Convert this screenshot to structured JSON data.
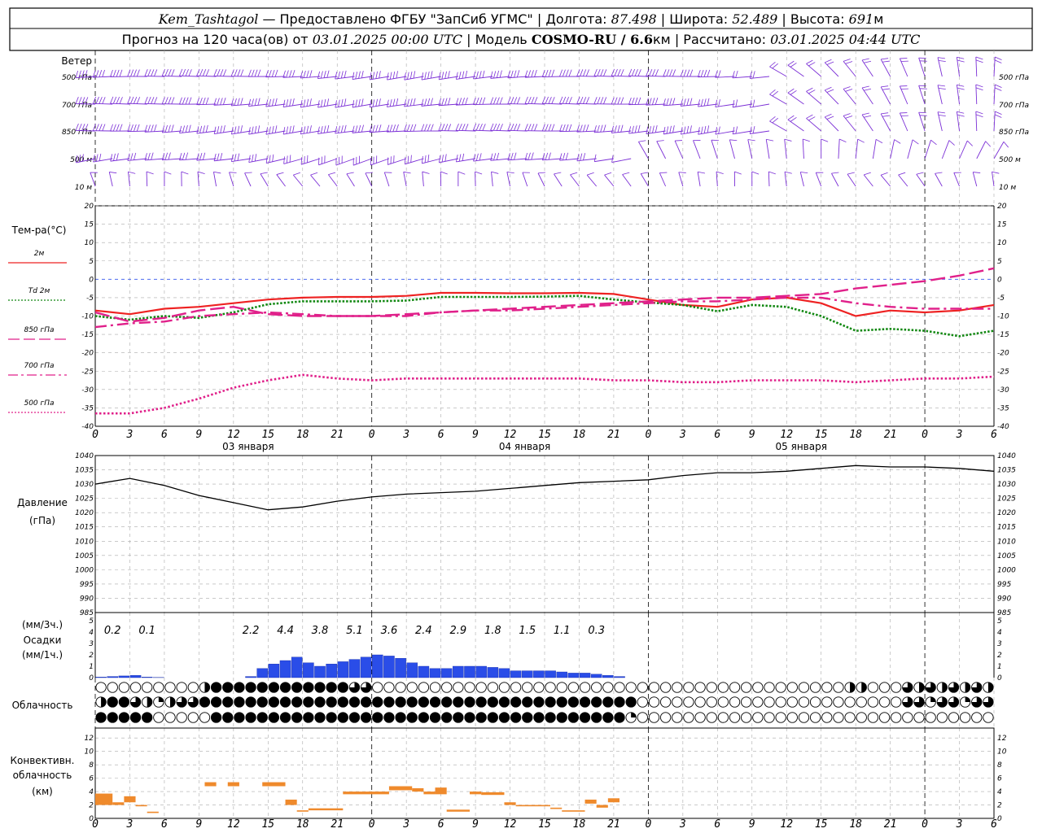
{
  "header": {
    "line1": {
      "station": "Kem_Tashtagol",
      "provider": "— Предоставлено ФГБУ \"ЗапСиб УГМС\"",
      "lon_label": "| Долгота:",
      "lon": "87.498",
      "lat_label": "| Широта:",
      "lat": "52.489",
      "alt_label": "| Высота:",
      "alt": "691",
      "alt_unit": "м"
    },
    "line2": {
      "forecast_label": "Прогноз на 120 часа(ов) от",
      "start": "03.01.2025 00:00 UTC",
      "model_label": "| Модель",
      "model": "COSMO-RU / 6.6",
      "model_unit": "км",
      "calc_label": "| Рассчитано:",
      "calc": "03.01.2025 04:44 UTC"
    }
  },
  "wind": {
    "title": "Ветер",
    "levels": [
      "500 гПа",
      "700 гПа",
      "850 гПа",
      "500 м",
      "10 м"
    ],
    "barb_color": "#7b2fd6"
  },
  "temperature": {
    "title": "Тем-ра(°С)",
    "yticks": [
      20,
      15,
      10,
      5,
      0,
      -5,
      -10,
      -15,
      -20,
      -25,
      -30,
      -35,
      -40
    ],
    "legend": [
      {
        "label": "2м",
        "color": "#ee2222",
        "style": "solid"
      },
      {
        "label": "Td  2м",
        "color": "#118811",
        "style": "dotted"
      },
      {
        "label": "850 гПа",
        "color": "#e0208a",
        "style": "longdash"
      },
      {
        "label": "700 гПа",
        "color": "#e0208a",
        "style": "dashdot"
      },
      {
        "label": "500 гПа",
        "color": "#e0208a",
        "style": "dotted"
      }
    ],
    "day_labels": [
      "03 января",
      "04 января",
      "05 января"
    ]
  },
  "pressure": {
    "title": "Давление",
    "unit": "(гПа)",
    "yticks": [
      1040,
      1035,
      1030,
      1025,
      1020,
      1015,
      1010,
      1005,
      1000,
      995,
      990,
      985
    ]
  },
  "precipitation": {
    "unit_3h": "(мм/3ч.)",
    "title": "Осадки",
    "unit_1h": "(мм/1ч.)",
    "yticks": [
      5,
      4,
      3,
      2,
      1,
      0
    ],
    "totals_3h": [
      {
        "hour": 3,
        "label": "0.2"
      },
      {
        "hour": 6,
        "label": "0.1"
      },
      {
        "hour": 15,
        "label": "2.2"
      },
      {
        "hour": 18,
        "label": "4.4"
      },
      {
        "hour": 21,
        "label": "3.8"
      },
      {
        "hour": 24,
        "label": "5.1"
      },
      {
        "hour": 27,
        "label": "3.6"
      },
      {
        "hour": 30,
        "label": "2.4"
      },
      {
        "hour": 33,
        "label": "2.9"
      },
      {
        "hour": 36,
        "label": "1.8"
      },
      {
        "hour": 39,
        "label": "1.5"
      },
      {
        "hour": 42,
        "label": "1.1"
      },
      {
        "hour": 45,
        "label": "0.3"
      }
    ]
  },
  "cloudiness": {
    "title": "Облачность"
  },
  "convective": {
    "title1": "Конвективн.",
    "title2": "облачность",
    "unit": "(км)",
    "yticks": [
      12,
      10,
      8,
      6,
      4,
      2,
      0
    ]
  },
  "x_axis": {
    "tick_labels": [
      "0",
      "3",
      "6",
      "9",
      "12",
      "15",
      "18",
      "21",
      "0",
      "3",
      "6",
      "9",
      "12",
      "15",
      "18",
      "21",
      "0",
      "3",
      "6",
      "9",
      "12",
      "15",
      "18",
      "21",
      "0",
      "3",
      "6"
    ]
  },
  "chart_data": {
    "type": "line",
    "x_unit": "hours since 03.01.2025 00:00 UTC",
    "series_temperature": [
      {
        "name": "2м",
        "x": [
          0,
          3,
          6,
          9,
          12,
          15,
          18,
          21,
          24,
          27,
          30,
          33,
          36,
          39,
          42,
          45,
          48,
          51,
          54,
          57,
          60,
          63,
          66,
          69,
          72,
          75,
          78
        ],
        "values": [
          -8.5,
          -9.5,
          -8.0,
          -7.5,
          -6.5,
          -5.5,
          -5.0,
          -4.8,
          -4.8,
          -4.5,
          -3.7,
          -3.7,
          -3.8,
          -3.8,
          -3.7,
          -4.0,
          -5.5,
          -7.0,
          -7.5,
          -5.5,
          -5.0,
          -6.5,
          -10.0,
          -8.5,
          -9.0,
          -8.5,
          -7.0
        ]
      },
      {
        "name": "Td  2м",
        "x": [
          0,
          3,
          6,
          9,
          12,
          15,
          18,
          21,
          24,
          27,
          30,
          33,
          36,
          39,
          42,
          45,
          48,
          51,
          54,
          57,
          60,
          63,
          66,
          69,
          72,
          75,
          78
        ],
        "values": [
          -10.0,
          -11.0,
          -10.0,
          -10.5,
          -9.0,
          -6.8,
          -6.0,
          -6.0,
          -6.0,
          -5.8,
          -4.8,
          -4.8,
          -4.8,
          -4.7,
          -4.5,
          -5.5,
          -6.3,
          -7.0,
          -8.7,
          -7.0,
          -7.5,
          -10.0,
          -14.0,
          -13.5,
          -14.0,
          -15.5,
          -14.0
        ]
      },
      {
        "name": "850 гПа",
        "x": [
          0,
          3,
          6,
          9,
          12,
          15,
          18,
          21,
          24,
          27,
          30,
          33,
          36,
          39,
          42,
          45,
          48,
          51,
          54,
          57,
          60,
          63,
          66,
          69,
          72,
          75,
          78
        ],
        "values": [
          -9.0,
          -11.5,
          -10.5,
          -8.5,
          -7.5,
          -9.5,
          -10.0,
          -10.0,
          -10.0,
          -9.5,
          -9.0,
          -8.5,
          -8.0,
          -7.5,
          -7.0,
          -6.5,
          -6.0,
          -5.5,
          -5.0,
          -5.0,
          -4.5,
          -4.0,
          -2.5,
          -1.5,
          -0.5,
          1.0,
          3.0
        ]
      },
      {
        "name": "700 гПа",
        "x": [
          0,
          3,
          6,
          9,
          12,
          15,
          18,
          21,
          24,
          27,
          30,
          33,
          36,
          39,
          42,
          45,
          48,
          51,
          54,
          57,
          60,
          63,
          66,
          69,
          72,
          75,
          78
        ],
        "values": [
          -13.0,
          -12.0,
          -11.5,
          -10.0,
          -9.5,
          -9.0,
          -9.5,
          -10.0,
          -10.0,
          -10.0,
          -9.0,
          -8.5,
          -8.5,
          -8.0,
          -7.5,
          -7.0,
          -6.5,
          -6.0,
          -6.0,
          -5.5,
          -5.0,
          -5.0,
          -6.5,
          -7.5,
          -8.0,
          -8.0,
          -8.0
        ]
      },
      {
        "name": "500 гПа",
        "x": [
          0,
          3,
          6,
          9,
          12,
          15,
          18,
          21,
          24,
          27,
          30,
          33,
          36,
          39,
          42,
          45,
          48,
          51,
          54,
          57,
          60,
          63,
          66,
          69,
          72,
          75,
          78
        ],
        "values": [
          -36.5,
          -36.5,
          -35.0,
          -32.5,
          -29.5,
          -27.5,
          -26.0,
          -27.0,
          -27.5,
          -27.0,
          -27.0,
          -27.0,
          -27.0,
          -27.0,
          -27.0,
          -27.5,
          -27.5,
          -28.0,
          -28.0,
          -27.5,
          -27.5,
          -27.5,
          -28.0,
          -27.5,
          -27.0,
          -27.0,
          -26.5
        ]
      }
    ],
    "series_pressure": {
      "name": "Давление",
      "x": [
        0,
        3,
        6,
        9,
        12,
        15,
        18,
        21,
        24,
        27,
        30,
        33,
        36,
        39,
        42,
        45,
        48,
        51,
        54,
        57,
        60,
        63,
        66,
        69,
        72,
        75,
        78
      ],
      "values": [
        1030.0,
        1032.0,
        1029.5,
        1026.0,
        1023.5,
        1021.0,
        1022.0,
        1024.0,
        1025.5,
        1026.5,
        1027.0,
        1027.5,
        1028.5,
        1029.5,
        1030.5,
        1031.0,
        1031.5,
        1033.0,
        1034.0,
        1034.0,
        1034.5,
        1035.5,
        1036.5,
        1036.0,
        1036.0,
        1035.5,
        1034.5
      ]
    },
    "series_precip_1h": {
      "name": "Осадки",
      "x": [
        0,
        1,
        2,
        3,
        4,
        5,
        6,
        7,
        8,
        9,
        10,
        11,
        12,
        13,
        14,
        15,
        16,
        17,
        18,
        19,
        20,
        21,
        22,
        23,
        24,
        25,
        26,
        27,
        28,
        29,
        30,
        31,
        32,
        33,
        34,
        35,
        36,
        37,
        38,
        39,
        40,
        41,
        42,
        43,
        44,
        45,
        46,
        47
      ],
      "values": [
        0.05,
        0.1,
        0.15,
        0.2,
        0.05,
        0.02,
        0,
        0,
        0,
        0,
        0,
        0,
        0,
        0.1,
        0.8,
        1.2,
        1.5,
        1.8,
        1.3,
        1.0,
        1.2,
        1.4,
        1.6,
        1.8,
        2.0,
        1.9,
        1.7,
        1.3,
        1.0,
        0.8,
        0.8,
        1.0,
        1.0,
        1.0,
        0.9,
        0.8,
        0.6,
        0.6,
        0.6,
        0.6,
        0.5,
        0.4,
        0.4,
        0.3,
        0.2,
        0.1,
        0,
        0
      ]
    },
    "series_convective": {
      "name": "Конвективн. облачность",
      "segments": [
        {
          "h0": 0,
          "h1": 1.5,
          "lo": 2.0,
          "hi": 3.7
        },
        {
          "h0": 1.5,
          "h1": 2.5,
          "lo": 2.0,
          "hi": 2.4
        },
        {
          "h0": 2.5,
          "h1": 3.5,
          "lo": 2.4,
          "hi": 3.3
        },
        {
          "h0": 3.5,
          "h1": 4.5,
          "lo": 1.8,
          "hi": 2.0
        },
        {
          "h0": 4.5,
          "h1": 5.5,
          "lo": 0.8,
          "hi": 1.0
        },
        {
          "h0": 9.5,
          "h1": 10.5,
          "lo": 4.8,
          "hi": 5.4
        },
        {
          "h0": 11.5,
          "h1": 12.5,
          "lo": 4.8,
          "hi": 5.4
        },
        {
          "h0": 14.5,
          "h1": 16.5,
          "lo": 4.8,
          "hi": 5.4
        },
        {
          "h0": 16.5,
          "h1": 17.5,
          "lo": 2.0,
          "hi": 2.8
        },
        {
          "h0": 17.5,
          "h1": 18.5,
          "lo": 1.0,
          "hi": 1.2
        },
        {
          "h0": 18.5,
          "h1": 21.5,
          "lo": 1.2,
          "hi": 1.5
        },
        {
          "h0": 21.5,
          "h1": 25.5,
          "lo": 3.6,
          "hi": 4.0
        },
        {
          "h0": 25.5,
          "h1": 27.5,
          "lo": 4.2,
          "hi": 4.8
        },
        {
          "h0": 27.5,
          "h1": 28.5,
          "lo": 4.0,
          "hi": 4.5
        },
        {
          "h0": 28.5,
          "h1": 29.5,
          "lo": 3.6,
          "hi": 4.0
        },
        {
          "h0": 29.5,
          "h1": 30.5,
          "lo": 3.6,
          "hi": 4.6
        },
        {
          "h0": 30.5,
          "h1": 32.5,
          "lo": 1.0,
          "hi": 1.3
        },
        {
          "h0": 32.5,
          "h1": 33.5,
          "lo": 3.6,
          "hi": 4.0
        },
        {
          "h0": 33.5,
          "h1": 35.5,
          "lo": 3.5,
          "hi": 3.9
        },
        {
          "h0": 35.5,
          "h1": 36.5,
          "lo": 2.0,
          "hi": 2.4
        },
        {
          "h0": 36.5,
          "h1": 39.5,
          "lo": 1.8,
          "hi": 2.0
        },
        {
          "h0": 39.5,
          "h1": 40.5,
          "lo": 1.4,
          "hi": 1.6
        },
        {
          "h0": 40.5,
          "h1": 42.5,
          "lo": 1.0,
          "hi": 1.2
        },
        {
          "h0": 42.5,
          "h1": 43.5,
          "lo": 2.2,
          "hi": 2.8
        },
        {
          "h0": 43.5,
          "h1": 44.5,
          "lo": 1.6,
          "hi": 2.0
        },
        {
          "h0": 44.5,
          "h1": 45.5,
          "lo": 2.4,
          "hi": 3.0
        }
      ]
    }
  }
}
